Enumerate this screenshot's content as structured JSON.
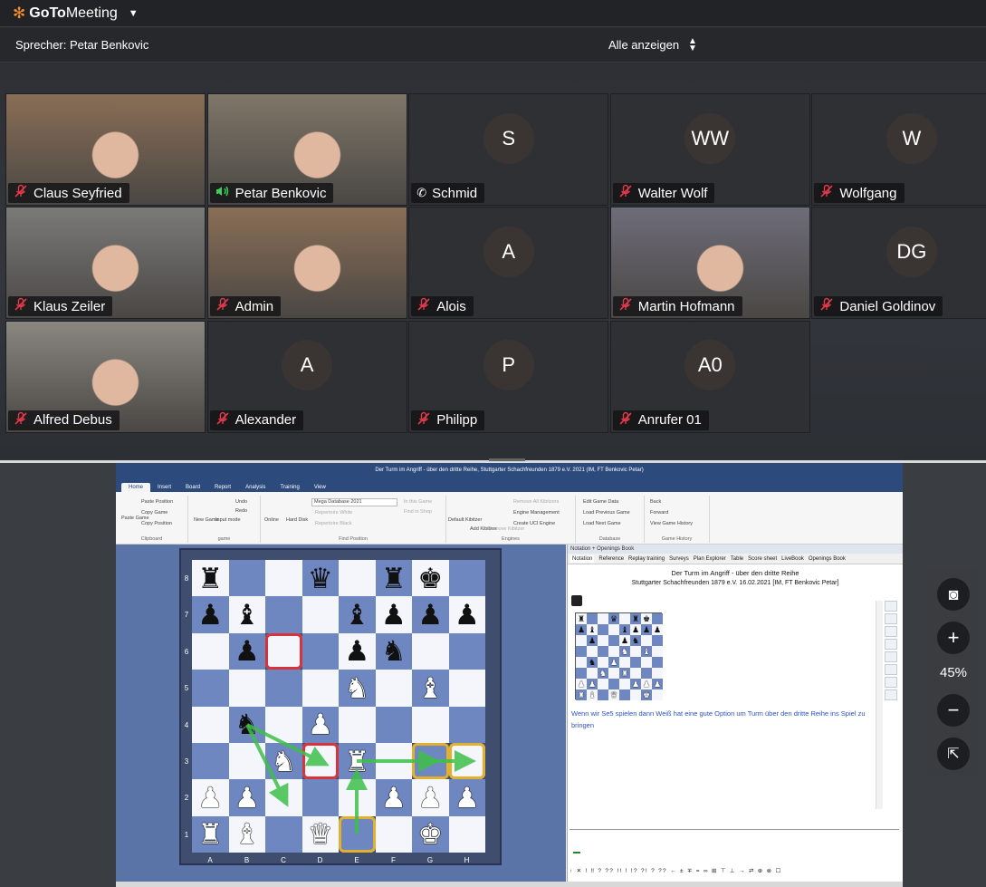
{
  "app": {
    "name_bold": "GoTo",
    "name_rest": "Meeting"
  },
  "speaker": {
    "label": "Sprecher: Petar Benkovic",
    "show_all": "Alle anzeigen"
  },
  "participants": [
    {
      "name": "Claus Seyfried",
      "initials": "",
      "camera": true,
      "audio": "muted"
    },
    {
      "name": "Petar Benkovic",
      "initials": "",
      "camera": true,
      "audio": "speaking"
    },
    {
      "name": "Schmid",
      "initials": "S",
      "camera": false,
      "audio": "phone"
    },
    {
      "name": "Walter Wolf",
      "initials": "WW",
      "camera": false,
      "audio": "muted"
    },
    {
      "name": "Wolfgang",
      "initials": "W",
      "camera": false,
      "audio": "muted"
    },
    {
      "name": "Klaus Zeiler",
      "initials": "",
      "camera": true,
      "audio": "muted"
    },
    {
      "name": "Admin",
      "initials": "",
      "camera": true,
      "audio": "muted"
    },
    {
      "name": "Alois",
      "initials": "A",
      "camera": false,
      "audio": "muted"
    },
    {
      "name": "Martin Hofmann",
      "initials": "",
      "camera": true,
      "audio": "muted"
    },
    {
      "name": "Daniel Goldinov",
      "initials": "DG",
      "camera": false,
      "audio": "muted"
    },
    {
      "name": "Alfred Debus",
      "initials": "",
      "camera": true,
      "audio": "muted"
    },
    {
      "name": "Alexander",
      "initials": "A",
      "camera": false,
      "audio": "muted"
    },
    {
      "name": "Philipp",
      "initials": "P",
      "camera": false,
      "audio": "muted"
    },
    {
      "name": "Anrufer 01",
      "initials": "A0",
      "camera": false,
      "audio": "muted"
    }
  ],
  "shared_app": {
    "title": "Der Turm im Angriff - über den dritte Reihe, Stuttgarter Schachfreunden 1879 e.V. 2021 (IM, FT Benkovic Petar)",
    "tabs": [
      "File",
      "Home",
      "Insert",
      "Board",
      "Report",
      "Analysis",
      "Training",
      "View"
    ],
    "active_tab": "Home",
    "ribbon": {
      "clipboard": {
        "label": "Clipboard",
        "paste": "Paste Game",
        "paste_pos": "Paste Position",
        "copy_game": "Copy Game",
        "copy_pos": "Copy Position"
      },
      "game": {
        "label": "game",
        "new_game": "New Game",
        "input_mode": "Input mode",
        "undo": "Undo",
        "redo": "Redo"
      },
      "find": {
        "label": "Find Position",
        "online": "Online",
        "hard_disk": "Hard Disk",
        "database": "Mega Database 2021",
        "rep_white": "Repertoire White",
        "rep_black": "Repertoire Black",
        "in_this_game": "In this Game",
        "find_in_shop": "Find in Shop"
      },
      "engines": {
        "label": "Engines",
        "default_kibitzer": "Default Kibitzer",
        "add_kibitzer": "Add Kibitzer",
        "remove_kibitzer": "Remove Kibitzer",
        "remove_all": "Remove All Kibitzers",
        "engine_mgmt": "Engine Management",
        "create_uci": "Create UCI Engine"
      },
      "database": {
        "label": "Database",
        "edit": "Edit Game Data",
        "load_prev": "Load Previous Game",
        "load_next": "Load Next Game"
      },
      "history": {
        "label": "Game History",
        "back": "Back",
        "forward": "Forward",
        "view": "View Game History"
      }
    },
    "board": {
      "ranks": [
        "8",
        "7",
        "6",
        "5",
        "4",
        "3",
        "2",
        "1"
      ],
      "files": [
        "A",
        "B",
        "C",
        "D",
        "E",
        "F",
        "G",
        "H"
      ],
      "position": [
        [
          "bR",
          "",
          "",
          "bQ",
          "",
          "bR",
          "bK",
          ""
        ],
        [
          "bP",
          "bB",
          "",
          "",
          "bB",
          "bP",
          "bP",
          "bP"
        ],
        [
          "",
          "bP",
          "",
          "",
          "bP",
          "bN",
          "",
          ""
        ],
        [
          "",
          "",
          "",
          "",
          "wN",
          "",
          "wB",
          ""
        ],
        [
          "",
          "bN",
          "",
          "wP",
          "",
          "",
          "",
          ""
        ],
        [
          "",
          "",
          "wN",
          "",
          "wR",
          "",
          "",
          ""
        ],
        [
          "wP",
          "wP",
          "",
          "",
          "",
          "wP",
          "wP",
          "wP"
        ],
        [
          "wR",
          "wB",
          "",
          "wQ",
          "",
          "",
          "wK",
          ""
        ]
      ]
    },
    "notation": {
      "pane_title": "Notation + Openings Book",
      "tabs": [
        "Notation",
        "Reference",
        "Replay training",
        "Surveys",
        "Plan Explorer",
        "Table",
        "Score sheet",
        "LiveBook",
        "Openings Book"
      ],
      "game_title": "Der Turm im Angriff - über den dritte Reihe",
      "game_sub": "Stuttgarter Schachfreunden 1879 e.V. 16.02.2021 [IM, FT Benkovic Petar]",
      "comment": "Wenn wir Se5 spielen dann Weiß hat eine gute Option um Turm über den dritte Reihe ins Spiel zu bringen",
      "symbols": "↑ ✕ ! ‼ ? ?? !! ! !? ?! ? ?? ← ± ∓ = ∞ ⊞ ⊤ ⊥ → ⇄ ⊕ ⊗ ☐",
      "progress": "0%"
    }
  },
  "zoom": {
    "percent": "45%"
  },
  "colors": {
    "accent": "#f68d2e",
    "muted_red": "#e0394a",
    "speaking_green": "#3ecf5a",
    "board_dark": "#6f87c0",
    "board_light": "#f4f6fb"
  }
}
